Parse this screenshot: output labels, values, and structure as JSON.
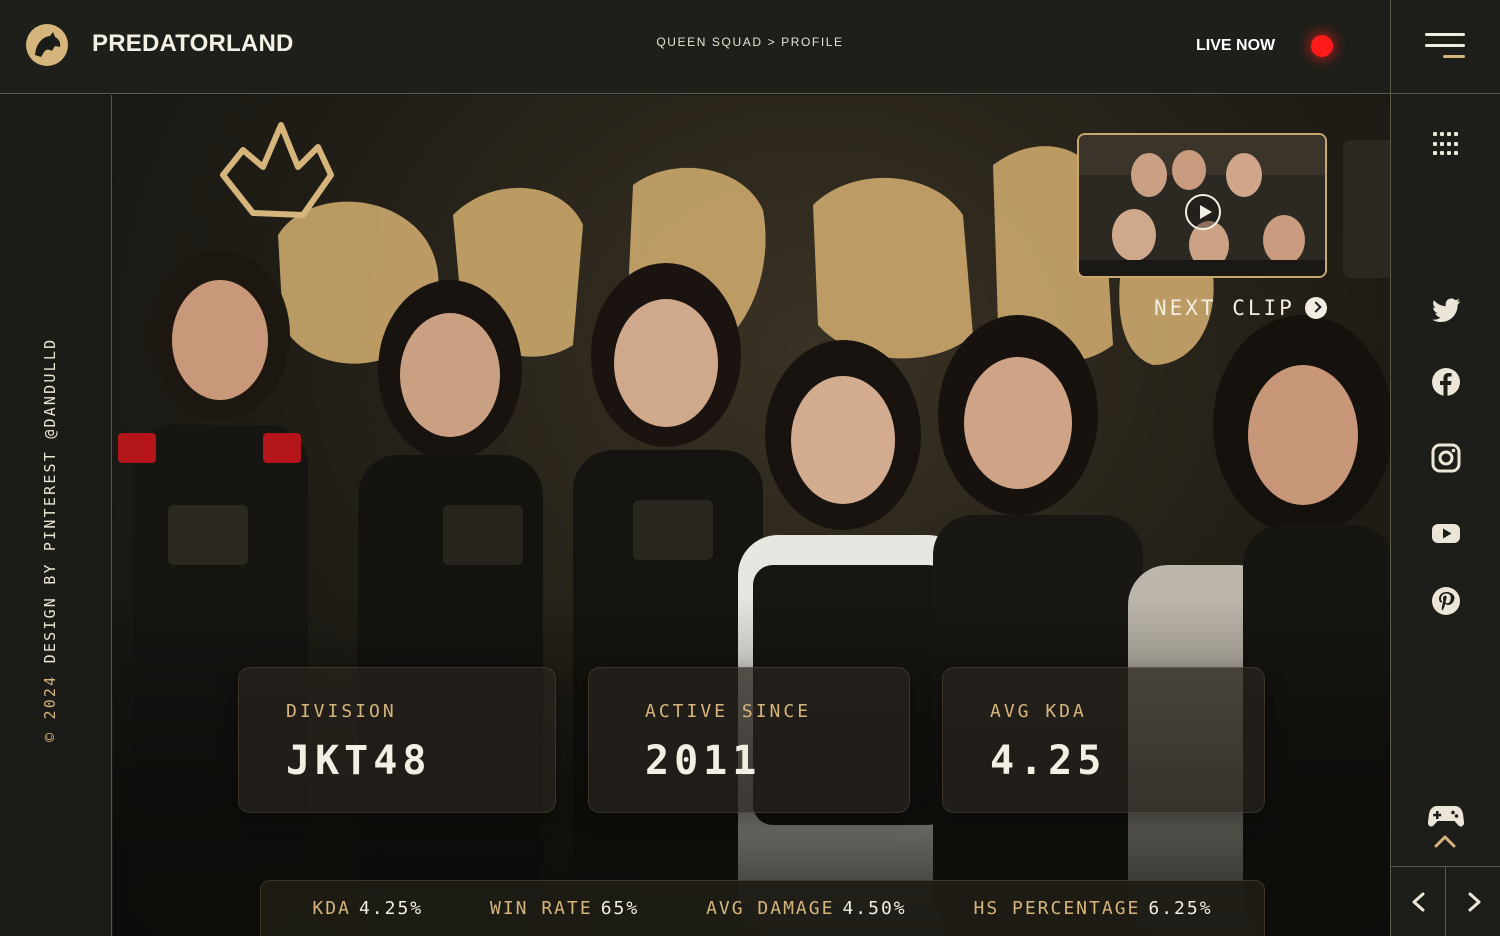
{
  "brand": {
    "name": "PREDATORLAND"
  },
  "breadcrumb": {
    "section": "QUEEN SQUAD",
    "separator": ">",
    "page": "PROFILE"
  },
  "live": {
    "label": "LIVE NOW",
    "indicator_color": "#ff1a1a"
  },
  "credit": {
    "year": "© 2024",
    "text": "DESIGN BY PINTEREST @DANDULLD"
  },
  "clip": {
    "next_label": "NEXT CLIP"
  },
  "stats": [
    {
      "label": "DIVISION",
      "value": "JKT48"
    },
    {
      "label": "ACTIVE SINCE",
      "value": "2011"
    },
    {
      "label": "AVG KDA",
      "value": "4.25"
    }
  ],
  "ticker": [
    {
      "label": "KDA",
      "value": "4.25%"
    },
    {
      "label": "WIN RATE",
      "value": "65%"
    },
    {
      "label": "AVG DAMAGE",
      "value": "4.50%"
    },
    {
      "label": "HS PERCENTAGE",
      "value": "6.25%"
    }
  ],
  "rail": {
    "icons": [
      "menu-icon",
      "apps-grid-icon",
      "twitter-icon",
      "facebook-icon",
      "instagram-icon",
      "youtube-icon",
      "pinterest-icon",
      "gamepad-icon",
      "chevron-up-icon",
      "arrow-left-icon",
      "arrow-right-icon"
    ]
  },
  "colors": {
    "accent": "#d6b57c",
    "background": "#171814",
    "text": "#f2ede0",
    "live": "#ff1a1a"
  }
}
